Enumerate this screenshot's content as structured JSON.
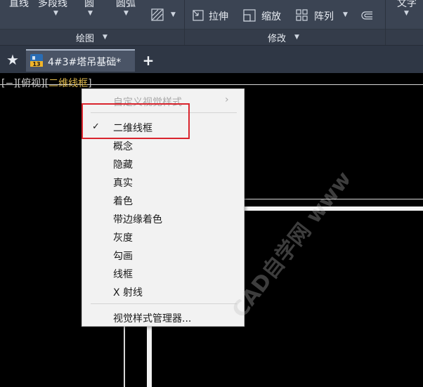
{
  "ribbon": {
    "draw_tools": [
      "直线",
      "多段线",
      "圆",
      "圆弧"
    ],
    "draw_panel_title": "绘图",
    "modify_tools": {
      "stretch": "拉伸",
      "scale": "缩放",
      "array": "阵列"
    },
    "modify_panel_title": "修改",
    "text_tool": "文字"
  },
  "tabs": {
    "active_document": "4#3#塔吊基础*",
    "doc_badge": "13",
    "new_tab_symbol": "+"
  },
  "viewport": {
    "bracket_open": "[",
    "control": "−",
    "view": "俯视",
    "style": "二维线框",
    "bracket_close": "]"
  },
  "context_menu": {
    "custom_styles": "自定义视觉样式",
    "items": [
      "二维线框",
      "概念",
      "隐藏",
      "真实",
      "着色",
      "带边缘着色",
      "灰度",
      "勾画",
      "线框",
      "X 射线"
    ],
    "checked_item": "二维线框",
    "manager": "视觉样式管理器..."
  },
  "watermark": {
    "text": "CAD自学网 www.cadzxw.com"
  },
  "colors": {
    "ribbon_bg": "#3b4453",
    "tab_bg": "#2f3745",
    "canvas_bg": "#000000",
    "menu_bg": "#f2f2f2",
    "highlight": "#d9242d",
    "viewport_style": "#d9b44a"
  }
}
